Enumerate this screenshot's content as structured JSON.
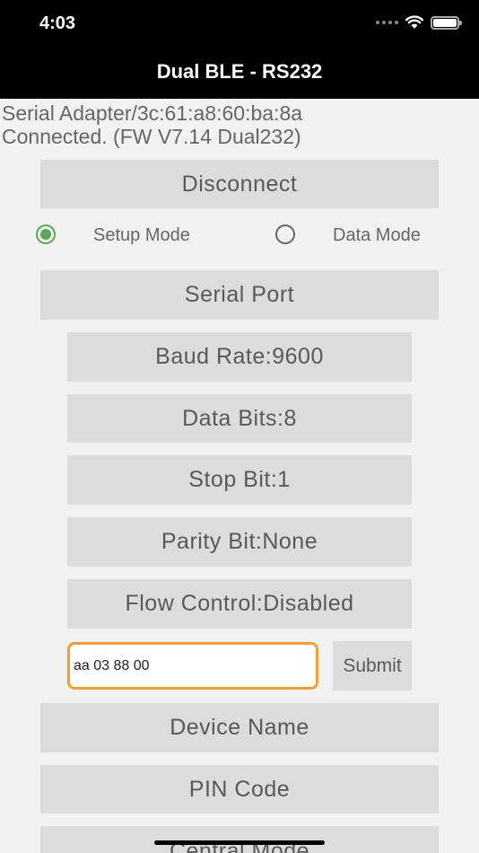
{
  "status_bar": {
    "time": "4:03",
    "icons": [
      "signal-dots-icon",
      "wifi-icon",
      "battery-icon"
    ]
  },
  "nav": {
    "title": "Dual BLE - RS232"
  },
  "device": {
    "line1": "Serial Adapter/3c:61:a8:60:ba:8a",
    "line2": "Connected. (FW V7.14 Dual232)"
  },
  "buttons": {
    "disconnect": "Disconnect",
    "serial_port": "Serial Port",
    "baud_rate": "Baud Rate:9600",
    "data_bits": "Data Bits:8",
    "stop_bit": "Stop Bit:1",
    "parity_bit": "Parity Bit:None",
    "flow_control": "Flow Control:Disabled",
    "submit": "Submit",
    "device_name": "Device Name",
    "pin_code": "PIN Code",
    "central_mode": "Central Mode"
  },
  "modes": {
    "setup": "Setup Mode",
    "data": "Data Mode",
    "selected": "Setup Mode"
  },
  "command": {
    "value": "aa 03 88 00"
  },
  "colors": {
    "radio_selected": "#5aa65a",
    "input_border": "#f0a030",
    "button_bg": "#dcdcdc",
    "header_bg": "#000000"
  }
}
